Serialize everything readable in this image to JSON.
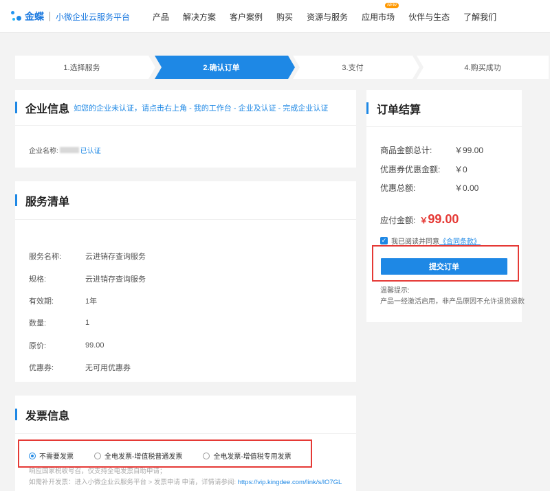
{
  "header": {
    "logo_text": "金蝶",
    "logo_sub": "小微企业云服务平台",
    "nav": [
      "产品",
      "解决方案",
      "客户案例",
      "购买",
      "资源与服务",
      "应用市场",
      "伙伴与生态",
      "了解我们"
    ],
    "nav_badge": "NEW"
  },
  "steps": [
    {
      "label": "1.选择服务",
      "active": false
    },
    {
      "label": "2.确认订单",
      "active": true
    },
    {
      "label": "3.支付",
      "active": false
    },
    {
      "label": "4.购买成功",
      "active": false
    }
  ],
  "company": {
    "title": "企业信息",
    "hint": "如您的企业未认证，请点击右上角 - 我的工作台 - 企业及认证 - 完成企业认证",
    "name_label": "企业名称:",
    "verified": "已认证"
  },
  "services": {
    "title": "服务清单",
    "rows": [
      {
        "label": "服务名称:",
        "value": "云进销存查询服务"
      },
      {
        "label": "规格:",
        "value": "云进销存查询服务"
      },
      {
        "label": "有效期:",
        "value": "1年"
      },
      {
        "label": "数量:",
        "value": "1"
      },
      {
        "label": "原价:",
        "value": "99.00"
      },
      {
        "label": "优惠券:",
        "value": "无可用优惠券"
      }
    ]
  },
  "invoice": {
    "title": "发票信息",
    "options": [
      "不需要发票",
      "全电发票-增值税普通发票",
      "全电发票-增值税专用发票"
    ],
    "selected": 0,
    "note1": "响应国家税收号召，仅支持全电发票自助申请；",
    "note2_prefix": "如需补开发票：进入小微企业云服务平台 > 发票申请 申请，详情请参阅: ",
    "note2_link": "https://vip.kingdee.com/link/s/lO7GL"
  },
  "summary": {
    "title": "订单结算",
    "rows": [
      {
        "label": "商品金额总计:",
        "value": "￥99.00"
      },
      {
        "label": "优惠券优惠金额:",
        "value": "￥0"
      },
      {
        "label": "优惠总额:",
        "value": "￥0.00"
      }
    ],
    "pay_label": "应付金额:",
    "pay_currency": "￥",
    "pay_amount": "99.00",
    "agree_text": "我已阅读并同意",
    "agree_link": "《合同条款》",
    "submit": "提交订单",
    "tip_title": "温馨提示:",
    "tip_text": "产品一经激活启用，非产品原因不允许退货退款"
  },
  "colors": {
    "accent": "#1e88e5",
    "price": "#e53935",
    "highlight_box": "#e53935"
  }
}
